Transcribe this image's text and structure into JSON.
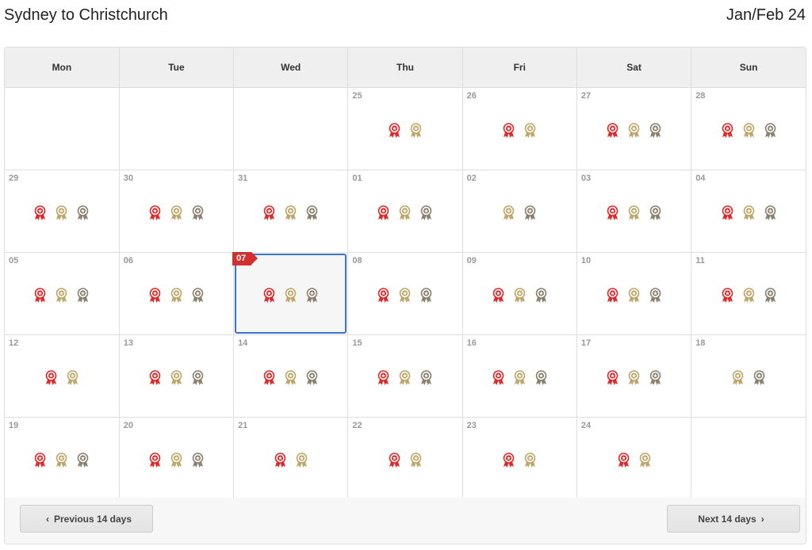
{
  "header": {
    "title": "Sydney to Christchurch",
    "month": "Jan/Feb 24"
  },
  "calendar": {
    "weekdays": [
      "Mon",
      "Tue",
      "Wed",
      "Thu",
      "Fri",
      "Sat",
      "Sun"
    ],
    "award_classes": {
      "business": {
        "color": "#e02a2a"
      },
      "premium": {
        "color": "#bfa76a"
      },
      "economy": {
        "color": "#8a8170"
      }
    },
    "weeks": [
      [
        {
          "day": "",
          "awards": []
        },
        {
          "day": "",
          "awards": []
        },
        {
          "day": "",
          "awards": []
        },
        {
          "day": "25",
          "awards": [
            "business",
            "premium"
          ]
        },
        {
          "day": "26",
          "awards": [
            "business",
            "premium"
          ]
        },
        {
          "day": "27",
          "awards": [
            "business",
            "premium",
            "economy"
          ]
        },
        {
          "day": "28",
          "awards": [
            "business",
            "premium",
            "economy"
          ]
        }
      ],
      [
        {
          "day": "29",
          "awards": [
            "business",
            "premium",
            "economy"
          ]
        },
        {
          "day": "30",
          "awards": [
            "business",
            "premium",
            "economy"
          ]
        },
        {
          "day": "31",
          "awards": [
            "business",
            "premium",
            "economy"
          ]
        },
        {
          "day": "01",
          "awards": [
            "business",
            "premium",
            "economy"
          ]
        },
        {
          "day": "02",
          "awards": [
            "premium",
            "economy"
          ]
        },
        {
          "day": "03",
          "awards": [
            "business",
            "premium",
            "economy"
          ]
        },
        {
          "day": "04",
          "awards": [
            "business",
            "premium",
            "economy"
          ]
        }
      ],
      [
        {
          "day": "05",
          "awards": [
            "business",
            "premium",
            "economy"
          ]
        },
        {
          "day": "06",
          "awards": [
            "business",
            "premium",
            "economy"
          ]
        },
        {
          "day": "07",
          "awards": [
            "business",
            "premium",
            "economy"
          ],
          "selected": true
        },
        {
          "day": "08",
          "awards": [
            "business",
            "premium",
            "economy"
          ]
        },
        {
          "day": "09",
          "awards": [
            "business",
            "premium",
            "economy"
          ]
        },
        {
          "day": "10",
          "awards": [
            "business",
            "premium",
            "economy"
          ]
        },
        {
          "day": "11",
          "awards": [
            "business",
            "premium",
            "economy"
          ]
        }
      ],
      [
        {
          "day": "12",
          "awards": [
            "business",
            "premium"
          ]
        },
        {
          "day": "13",
          "awards": [
            "business",
            "premium",
            "economy"
          ]
        },
        {
          "day": "14",
          "awards": [
            "business",
            "premium",
            "economy"
          ]
        },
        {
          "day": "15",
          "awards": [
            "business",
            "premium",
            "economy"
          ]
        },
        {
          "day": "16",
          "awards": [
            "business",
            "premium",
            "economy"
          ]
        },
        {
          "day": "17",
          "awards": [
            "business",
            "premium",
            "economy"
          ]
        },
        {
          "day": "18",
          "awards": [
            "premium",
            "economy"
          ]
        }
      ],
      [
        {
          "day": "19",
          "awards": [
            "business",
            "premium",
            "economy"
          ]
        },
        {
          "day": "20",
          "awards": [
            "business",
            "premium",
            "economy"
          ]
        },
        {
          "day": "21",
          "awards": [
            "business",
            "premium"
          ]
        },
        {
          "day": "22",
          "awards": [
            "business",
            "premium"
          ]
        },
        {
          "day": "23",
          "awards": [
            "business",
            "premium"
          ]
        },
        {
          "day": "24",
          "awards": [
            "business",
            "premium"
          ]
        },
        {
          "day": "",
          "awards": []
        }
      ]
    ]
  },
  "footer": {
    "prev_label": "Previous 14 days",
    "next_label": "Next 14 days",
    "prev_icon": "‹",
    "next_icon": "›"
  }
}
